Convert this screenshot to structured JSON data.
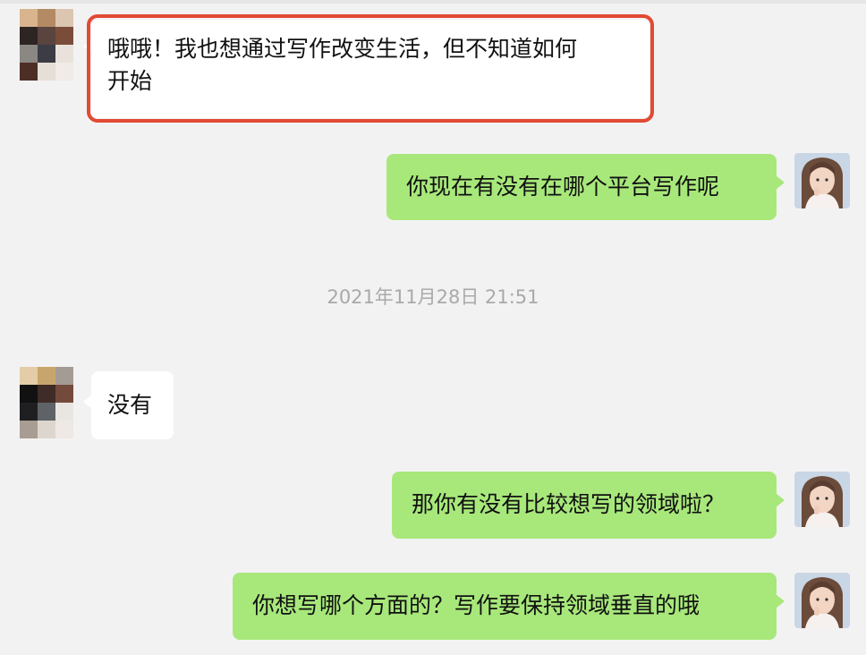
{
  "conversation": {
    "timestamp": "2021年11月28日 21:51",
    "messages": [
      {
        "side": "in",
        "text_line1": "哦哦！我也想通过写作改变生活，但不知道如何",
        "text_line2": "开始",
        "highlighted": true
      },
      {
        "side": "out",
        "text": "你现在有没有在哪个平台写作呢"
      },
      {
        "side": "in",
        "text": "没有"
      },
      {
        "side": "out",
        "text": "那你有没有比较想写的领域啦？"
      },
      {
        "side": "out",
        "text": "你想写哪个方面的？写作要保持领域垂直的哦"
      }
    ]
  },
  "colors": {
    "background": "#f3f2f3",
    "incoming_bubble": "#ffffff",
    "outgoing_bubble": "#a8e87b",
    "highlight_border": "#e24a33",
    "timestamp_text": "#a9a9a9"
  },
  "avatars": {
    "contact": "pixelated-avatar",
    "self": "girl-photo-avatar"
  }
}
